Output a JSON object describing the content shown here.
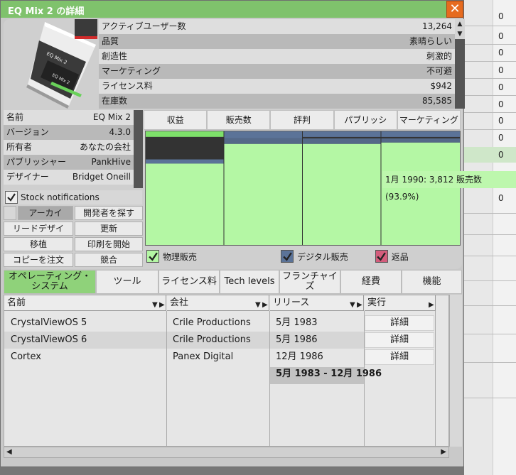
{
  "window": {
    "title": "EQ Mix 2 の詳細"
  },
  "product_art": {
    "label": "EQ Mix 2",
    "sublabel": "EQ Mix 2"
  },
  "stats": [
    {
      "label": "アクティブユーザー数",
      "value": "13,264"
    },
    {
      "label": "品質",
      "value": "素晴らしい"
    },
    {
      "label": "創造性",
      "value": "刺激的"
    },
    {
      "label": "マーケティング",
      "value": "不可避"
    },
    {
      "label": "ライセンス料",
      "value": "$942"
    },
    {
      "label": "在庫数",
      "value": "85,585"
    }
  ],
  "info": [
    {
      "label": "名前",
      "value": "EQ Mix 2"
    },
    {
      "label": "バージョン",
      "value": "4.3.0"
    },
    {
      "label": "所有者",
      "value": "あなたの会社"
    },
    {
      "label": "パブリッシャー",
      "value": "PankHive"
    },
    {
      "label": "デザイナー",
      "value": "Bridget Oneill"
    }
  ],
  "notifications": {
    "label": "Stock notifications",
    "checked": true
  },
  "actions": {
    "archive": "アーカイ",
    "find_developer": "開発者を探す",
    "lead_design": "リードデザイ",
    "update": "更新",
    "port": "移植",
    "start_print": "印刷を開始",
    "copy_order": "コピーを注文",
    "compete": "競合"
  },
  "chart_tabs": [
    "収益",
    "販売数",
    "評判",
    "パブリッシ",
    "マーケティング"
  ],
  "chart_data": {
    "type": "bar",
    "active_tab": "販売数",
    "series": [
      {
        "name": "物理販売",
        "color": "#b4f7a4"
      },
      {
        "name": "デジタル販売",
        "color": "#5b7398"
      },
      {
        "name": "返品",
        "color": "#d45d7c"
      }
    ],
    "tooltip": "1月 1990: 3,812 販売数 (93.9%)"
  },
  "legend": {
    "physical": "物理販売",
    "digital": "デジタル販売",
    "returns": "返品"
  },
  "tabs": [
    "オペレーティング・システム",
    "ツール",
    "ライセンス料",
    "Tech levels",
    "フランチャイズ",
    "経費",
    "機能"
  ],
  "table": {
    "headers": {
      "name": "名前",
      "company": "会社",
      "release": "リリース",
      "run": "実行"
    },
    "rows": [
      {
        "name": "CrystalViewOS 5",
        "company": "Crile Productions",
        "release": "5月 1983",
        "action": "詳細"
      },
      {
        "name": "CrystalViewOS 6",
        "company": "Crile Productions",
        "release": "5月 1986",
        "action": "詳細"
      },
      {
        "name": "Cortex",
        "company": "Panex Digital",
        "release": "12月 1986",
        "action": "詳細"
      }
    ],
    "summary_release": "5月 1983 - 12月 1986"
  },
  "background": {
    "cells": [
      "0",
      "0",
      "0",
      "0",
      "0",
      "0",
      "0",
      "0",
      "0",
      "0"
    ]
  }
}
